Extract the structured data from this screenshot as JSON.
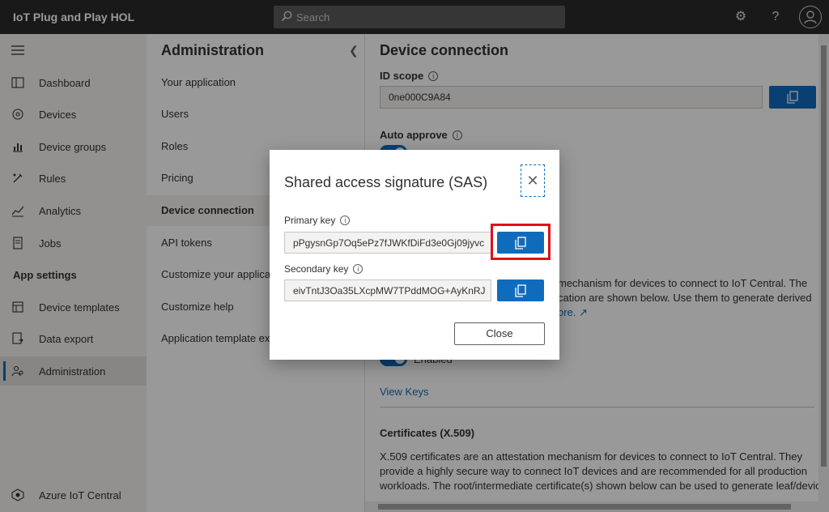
{
  "topbar": {
    "app_title": "IoT Plug and Play HOL",
    "search_placeholder": "Search"
  },
  "nav": {
    "items": [
      {
        "label": "Dashboard"
      },
      {
        "label": "Devices"
      },
      {
        "label": "Device groups"
      },
      {
        "label": "Rules"
      },
      {
        "label": "Analytics"
      },
      {
        "label": "Jobs"
      }
    ],
    "section_label": "App settings",
    "settings_items": [
      {
        "label": "Device templates"
      },
      {
        "label": "Data export"
      },
      {
        "label": "Administration"
      }
    ],
    "footer_label": "Azure IoT Central"
  },
  "admin": {
    "title": "Administration",
    "items": [
      {
        "label": "Your application"
      },
      {
        "label": "Users"
      },
      {
        "label": "Roles"
      },
      {
        "label": "Pricing"
      },
      {
        "label": "Device connection"
      },
      {
        "label": "API tokens"
      },
      {
        "label": "Customize your applicat"
      },
      {
        "label": "Customize help"
      },
      {
        "label": "Application template ex"
      }
    ]
  },
  "main": {
    "title": "Device connection",
    "id_scope_label": "ID scope",
    "id_scope_value": "0ne000C9A84",
    "auto_approve_label": "Auto approve",
    "sas_text_line1": "mechanism for devices to connect to IoT Central. The",
    "sas_text_line2": "cation are shown below. Use them to generate derived",
    "sas_text_line3_link": "ore.",
    "enabled_label": "Enabled",
    "view_keys": "View Keys",
    "certificates_heading": "Certificates (X.509)",
    "cert_text_line1": "X.509 certificates are an attestation mechanism for devices to connect to IoT Central. They",
    "cert_text_line2": "provide a highly secure way to connect IoT devices and are recommended for all production",
    "cert_text_line3": "workloads. The root/intermediate certificate(s) shown below can be used to generate leaf/device"
  },
  "dialog": {
    "title": "Shared access signature (SAS)",
    "primary_label": "Primary key",
    "primary_value": "pPgysnGp7Oq5ePz7fJWKfDiFd3e0Gj09jyvc",
    "secondary_label": "Secondary key",
    "secondary_value": "eivTntJ3Oa35LXcpMW7TPddMOG+AyKnRJ",
    "close_label": "Close"
  }
}
